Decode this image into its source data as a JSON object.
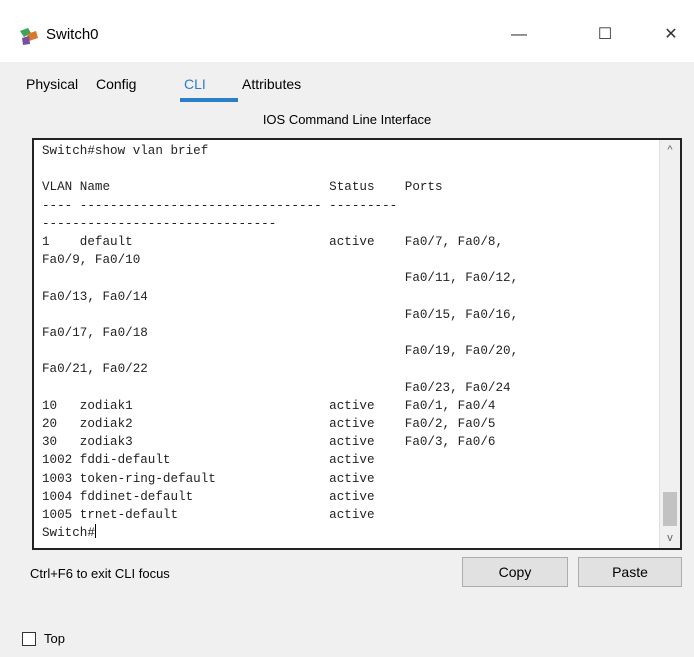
{
  "window": {
    "title": "Switch0",
    "minimize_glyph": "—",
    "maximize_glyph": "☐",
    "close_glyph": "✕",
    "icon": "switch-device-icon"
  },
  "tabs": [
    {
      "label": "Physical",
      "active": false
    },
    {
      "label": "Config",
      "active": false
    },
    {
      "label": "CLI",
      "active": true
    },
    {
      "label": "Attributes",
      "active": false
    }
  ],
  "section_title": "IOS Command Line Interface",
  "cli": {
    "lines": [
      "Switch#show vlan brief",
      "",
      "VLAN Name                             Status    Ports",
      "---- -------------------------------- ---------",
      "-------------------------------",
      "1    default                          active    Fa0/7, Fa0/8,",
      "Fa0/9, Fa0/10",
      "                                                Fa0/11, Fa0/12,",
      "Fa0/13, Fa0/14",
      "                                                Fa0/15, Fa0/16,",
      "Fa0/17, Fa0/18",
      "                                                Fa0/19, Fa0/20,",
      "Fa0/21, Fa0/22",
      "                                                Fa0/23, Fa0/24",
      "10   zodiak1                          active    Fa0/1, Fa0/4",
      "20   zodiak2                          active    Fa0/2, Fa0/5",
      "30   zodiak3                          active    Fa0/3, Fa0/6",
      "1002 fddi-default                     active",
      "1003 token-ring-default               active",
      "1004 fddinet-default                  active",
      "1005 trnet-default                    active"
    ],
    "prompt": "Switch#"
  },
  "scrollbar": {
    "up_glyph": "^",
    "down_glyph": "v"
  },
  "footer": {
    "focus_hint": "Ctrl+F6 to exit CLI focus",
    "copy_label": "Copy",
    "paste_label": "Paste",
    "top_label": "Top",
    "top_checked": false
  },
  "colors": {
    "accent": "#2a7fc9",
    "panel": "#f0f0f0"
  }
}
